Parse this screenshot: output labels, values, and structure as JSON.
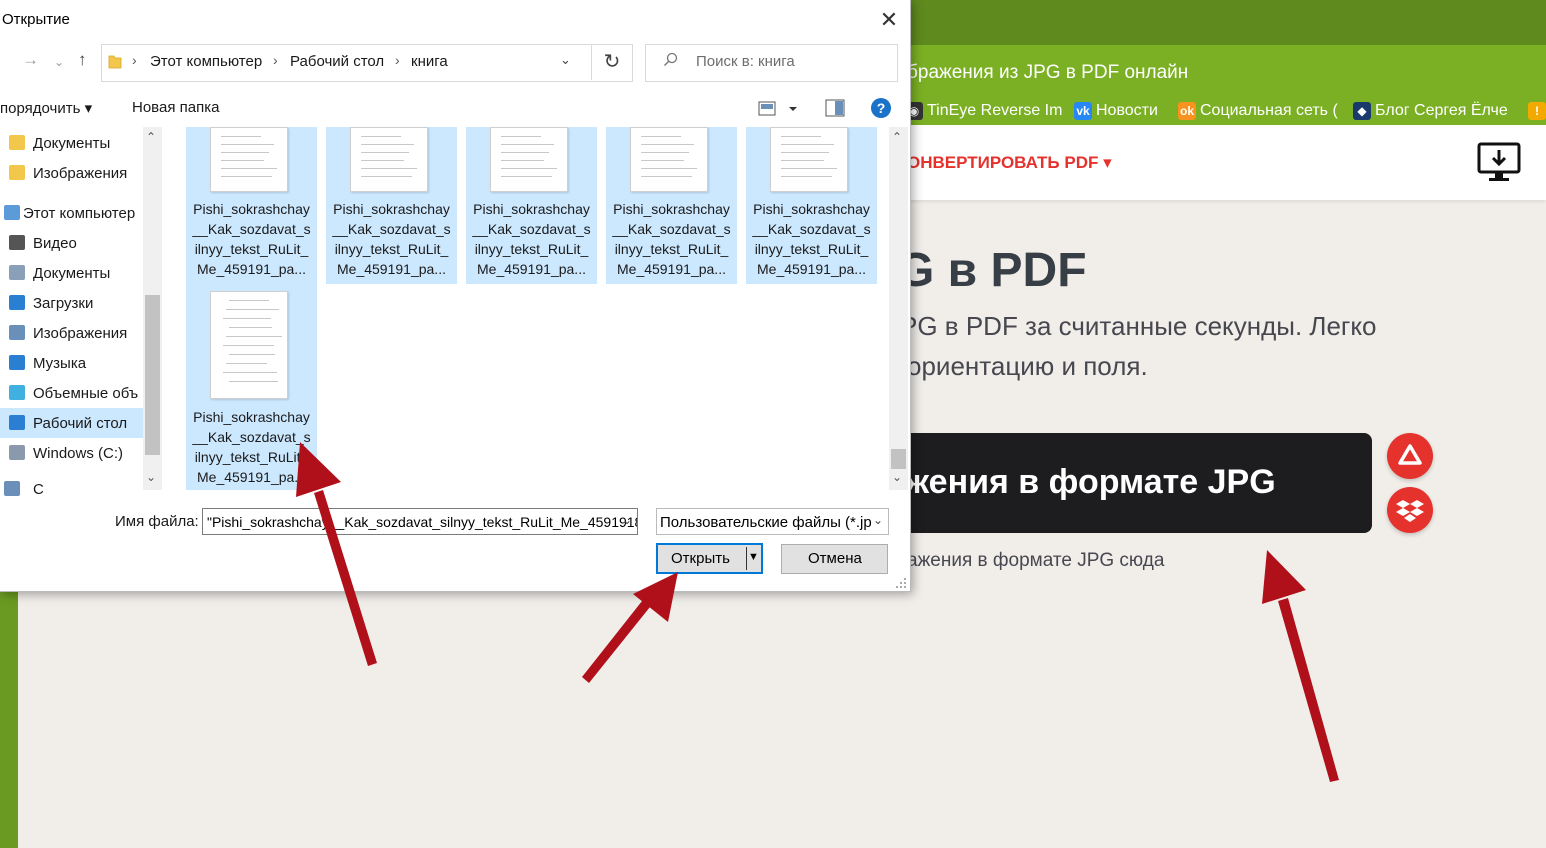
{
  "browser": {
    "tab_title": "бражения из JPG в PDF онлайн",
    "bookmarks": [
      {
        "label": "TinEye Reverse Im",
        "icon": "tineye-icon"
      },
      {
        "label": "Новости",
        "icon": "vk-icon"
      },
      {
        "label": "Социальная сеть (",
        "icon": "odnoklassniki-icon"
      },
      {
        "label": "Блог Сергея Ёлче",
        "icon": "blog-icon"
      }
    ]
  },
  "site": {
    "nav_convert": "ОНВЕРТИРОВАТЬ PDF ▾",
    "hero_title": "G в PDF",
    "hero_sub_1": "PG в PDF за считанные секунды. Легко",
    "hero_sub_2": "ориентацию и поля.",
    "select_button": "жения в формате JPG",
    "drop_hint": "ажения в формате JPG сюда"
  },
  "dialog": {
    "title": "Открытие",
    "breadcrumbs": [
      "Этот компьютер",
      "Рабочий стол",
      "книга"
    ],
    "search_placeholder": "Поиск в: книга",
    "toolbar": {
      "organize": "порядочить ▾",
      "new_folder": "Новая папка",
      "help": "?"
    },
    "nav_items": [
      {
        "label": "Документы",
        "icon": "folder-icon"
      },
      {
        "label": "Изображения",
        "icon": "folder-icon"
      },
      {
        "label": "Этот компьютер",
        "icon": "computer-icon"
      },
      {
        "label": "Видео",
        "icon": "video-icon"
      },
      {
        "label": "Документы",
        "icon": "documents-icon"
      },
      {
        "label": "Загрузки",
        "icon": "downloads-icon"
      },
      {
        "label": "Изображения",
        "icon": "pictures-icon"
      },
      {
        "label": "Музыка",
        "icon": "music-icon"
      },
      {
        "label": "Объемные объ",
        "icon": "3d-objects-icon"
      },
      {
        "label": "Рабочий стол",
        "icon": "desktop-icon"
      },
      {
        "label": "Windows (C:)",
        "icon": "drive-icon"
      },
      {
        "label": "С",
        "icon": "network-icon"
      }
    ],
    "files": [
      {
        "l1": "Pishi_sokrashchay",
        "l2": "__Kak_sozdavat_s",
        "l3": "ilnyy_tekst_RuLit_",
        "l4": "Me_459191_pa..."
      },
      {
        "l1": "Pishi_sokrashchay",
        "l2": "__Kak_sozdavat_s",
        "l3": "ilnyy_tekst_RuLit_",
        "l4": "Me_459191_pa..."
      },
      {
        "l1": "Pishi_sokrashchay",
        "l2": "__Kak_sozdavat_s",
        "l3": "ilnyy_tekst_RuLit_",
        "l4": "Me_459191_pa..."
      },
      {
        "l1": "Pishi_sokrashchay",
        "l2": "__Kak_sozdavat_s",
        "l3": "ilnyy_tekst_RuLit_",
        "l4": "Me_459191_pa..."
      },
      {
        "l1": "Pishi_sokrashchay",
        "l2": "__Kak_sozdavat_s",
        "l3": "ilnyy_tekst_RuLit_",
        "l4": "Me_459191_pa..."
      },
      {
        "l1": "Pishi_sokrashchay",
        "l2": "__Kak_sozdavat_s",
        "l3": "ilnyy_tekst_RuLit_",
        "l4": "Me_459191_pa..."
      }
    ],
    "filename_label": "Имя файла:",
    "filename_value": "\"Pishi_sokrashchay__Kak_sozdavat_silnyy_tekst_RuLit_Me_4591918",
    "filetype_value": "Пользовательские файлы (*.jp",
    "open_button": "Открыть",
    "cancel_button": "Отмена"
  },
  "colors": {
    "browser_green": "#7bb024",
    "brand_red": "#e5322d",
    "selection_blue": "#cce8ff",
    "annotation_arrow": "#b0101a"
  }
}
